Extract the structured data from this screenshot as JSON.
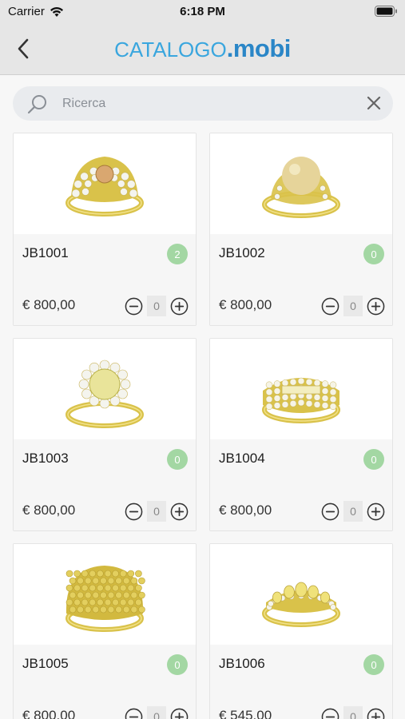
{
  "status": {
    "carrier": "Carrier",
    "time": "6:18 PM"
  },
  "nav": {
    "brand_part1": "CATALOGO",
    "brand_part2": ".mobi",
    "back_icon": "chevron-left-icon"
  },
  "search": {
    "placeholder": "Ricerca",
    "value": "",
    "icon": "search-icon",
    "clear_icon": "close-icon"
  },
  "colors": {
    "brand_light": "#3aa6de",
    "brand_dark": "#2a86c7",
    "badge": "#a3d7a3",
    "gold": "#d9c24a"
  },
  "products": [
    {
      "code": "JB1001",
      "count": "2",
      "price": "€ 800,00",
      "qty": "0",
      "ring": "stone-cluster",
      "stone": "#d9a770"
    },
    {
      "code": "JB1002",
      "count": "0",
      "price": "€ 800,00",
      "qty": "0",
      "ring": "pearl",
      "stone": "#e6d49a"
    },
    {
      "code": "JB1003",
      "count": "0",
      "price": "€ 800,00",
      "qty": "0",
      "ring": "halo",
      "stone": "#e9e49a"
    },
    {
      "code": "JB1004",
      "count": "0",
      "price": "€ 800,00",
      "qty": "0",
      "ring": "band-rows",
      "stone": "#f3eec0"
    },
    {
      "code": "JB1005",
      "count": "0",
      "price": "€ 800,00",
      "qty": "0",
      "ring": "dome-pave",
      "stone": "#d9c24a"
    },
    {
      "code": "JB1006",
      "count": "0",
      "price": "€ 545,00",
      "qty": "0",
      "ring": "oval-row",
      "stone": "#f0e27a"
    }
  ]
}
